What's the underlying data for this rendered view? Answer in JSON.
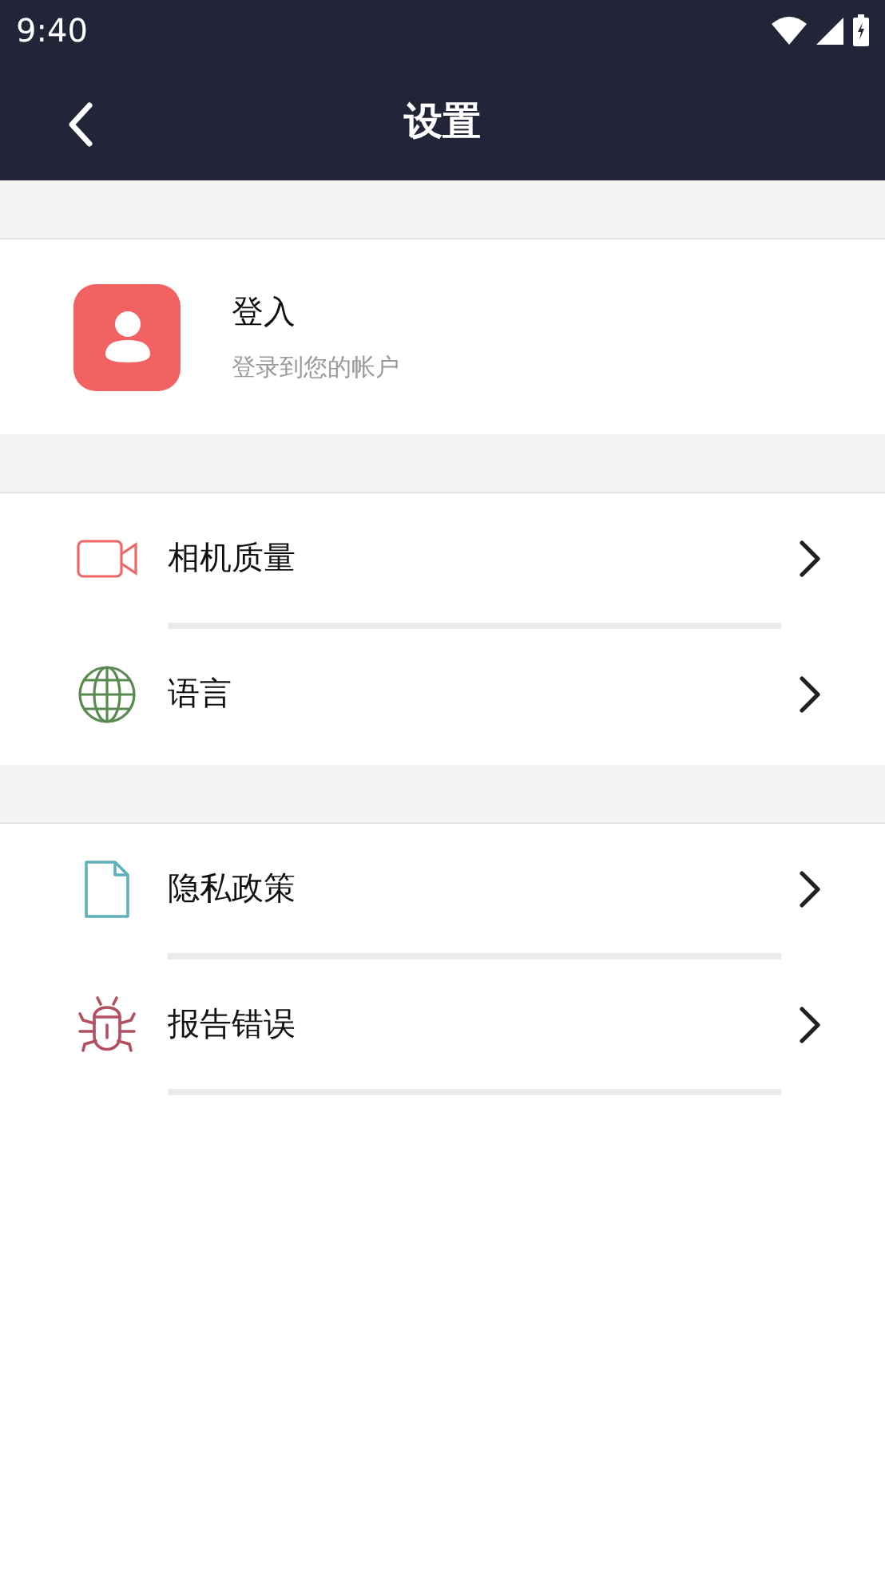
{
  "status_bar": {
    "time": "9:40"
  },
  "header": {
    "title": "设置"
  },
  "account": {
    "title": "登入",
    "subtitle": "登录到您的帐户"
  },
  "sections": [
    {
      "items": [
        {
          "label": "相机质量",
          "divider": true
        },
        {
          "label": "语言",
          "divider": false
        }
      ]
    },
    {
      "items": [
        {
          "label": "隐私政策",
          "divider": true
        },
        {
          "label": "报告错误",
          "divider": true
        }
      ]
    }
  ]
}
